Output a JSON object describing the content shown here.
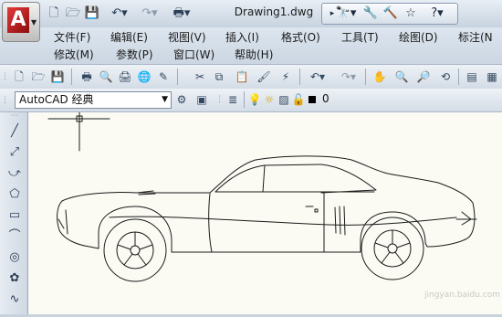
{
  "app": {
    "document_title": "Drawing1.dwg",
    "workspace": "AutoCAD 经典",
    "layer_name": "0",
    "watermark": "jingyan.baidu.com"
  },
  "menus": {
    "row1": [
      "文件(F)",
      "编辑(E)",
      "视图(V)",
      "插入(I)",
      "格式(O)",
      "工具(T)",
      "绘图(D)",
      "标注(N"
    ],
    "row2": [
      "修改(M)",
      "参数(P)",
      "窗口(W)",
      "帮助(H)"
    ]
  },
  "colors": {
    "canvas_bg": "#fbfbf4",
    "drawing_stroke": "#1a1a1a",
    "logo_red": "#c62020"
  }
}
